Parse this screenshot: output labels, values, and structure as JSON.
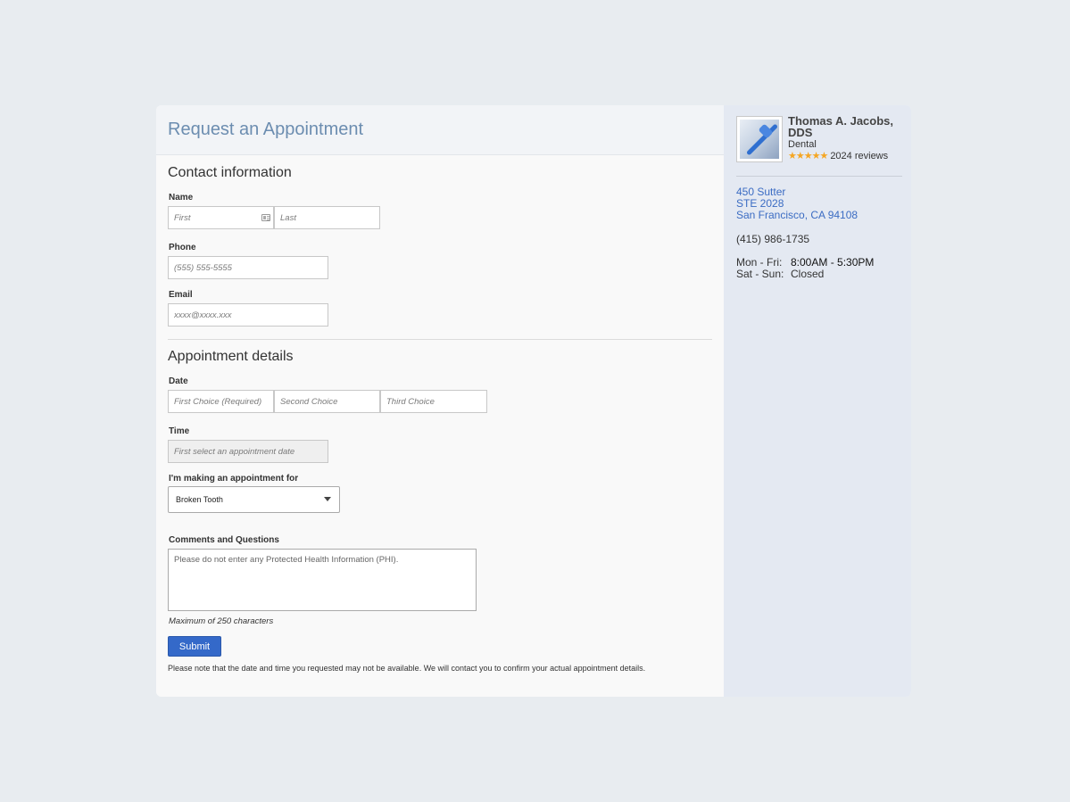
{
  "page": {
    "title": "Request an Appointment"
  },
  "contact": {
    "section_title": "Contact information",
    "name_label": "Name",
    "first_placeholder": "First",
    "last_placeholder": "Last",
    "phone_label": "Phone",
    "phone_placeholder": "(555) 555-5555",
    "email_label": "Email",
    "email_placeholder": "xxxx@xxxx.xxx"
  },
  "appointment": {
    "section_title": "Appointment details",
    "date_label": "Date",
    "date_choices": [
      "First Choice (Required)",
      "Second Choice",
      "Third Choice"
    ],
    "time_label": "Time",
    "time_placeholder": "First select an appointment date",
    "reason_label": "I'm making an appointment for",
    "reason_selected": "Broken Tooth",
    "comments_label": "Comments and Questions",
    "comments_placeholder": "Please do not enter any Protected Health Information (PHI).",
    "comments_hint": "Maximum of 250 characters",
    "submit_label": "Submit",
    "note": "Please note that the date and time you requested may not be available. We will contact you to confirm your actual appointment details."
  },
  "doctor": {
    "name": "Thomas A. Jacobs, DDS",
    "specialty": "Dental",
    "stars": "★★★★★",
    "rating_value": 5,
    "reviews": "2024 reviews",
    "address": [
      "450 Sutter",
      "STE 2028",
      "San Francisco, CA 94108"
    ],
    "phone": "(415) 986-1735",
    "hours": [
      {
        "days": "Mon - Fri:",
        "time": "8:00AM - 5:30PM"
      },
      {
        "days": "Sat - Sun:",
        "time": "Closed"
      }
    ]
  },
  "colors": {
    "accent": "#3469c9",
    "title": "#6c8db0",
    "link": "#3b6cc3",
    "star": "#f5a623",
    "sidebar_bg": "#e4e9f2"
  },
  "icons": {
    "name_field": "contact-card-icon",
    "select": "chevron-down-icon",
    "avatar": "toothbrush-image"
  }
}
